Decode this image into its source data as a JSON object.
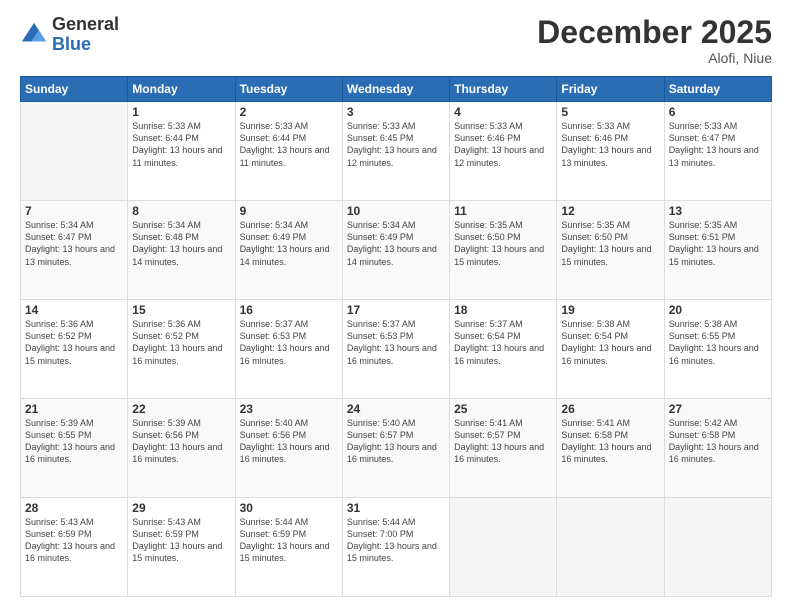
{
  "header": {
    "logo": {
      "general": "General",
      "blue": "Blue"
    },
    "title": "December 2025",
    "location": "Alofi, Niue"
  },
  "weekdays": [
    "Sunday",
    "Monday",
    "Tuesday",
    "Wednesday",
    "Thursday",
    "Friday",
    "Saturday"
  ],
  "weeks": [
    [
      {
        "day": "",
        "info": ""
      },
      {
        "day": "1",
        "info": "Sunrise: 5:33 AM\nSunset: 6:44 PM\nDaylight: 13 hours\nand 11 minutes."
      },
      {
        "day": "2",
        "info": "Sunrise: 5:33 AM\nSunset: 6:44 PM\nDaylight: 13 hours\nand 11 minutes."
      },
      {
        "day": "3",
        "info": "Sunrise: 5:33 AM\nSunset: 6:45 PM\nDaylight: 13 hours\nand 12 minutes."
      },
      {
        "day": "4",
        "info": "Sunrise: 5:33 AM\nSunset: 6:46 PM\nDaylight: 13 hours\nand 12 minutes."
      },
      {
        "day": "5",
        "info": "Sunrise: 5:33 AM\nSunset: 6:46 PM\nDaylight: 13 hours\nand 13 minutes."
      },
      {
        "day": "6",
        "info": "Sunrise: 5:33 AM\nSunset: 6:47 PM\nDaylight: 13 hours\nand 13 minutes."
      }
    ],
    [
      {
        "day": "7",
        "info": "Sunrise: 5:34 AM\nSunset: 6:47 PM\nDaylight: 13 hours\nand 13 minutes."
      },
      {
        "day": "8",
        "info": "Sunrise: 5:34 AM\nSunset: 6:48 PM\nDaylight: 13 hours\nand 14 minutes."
      },
      {
        "day": "9",
        "info": "Sunrise: 5:34 AM\nSunset: 6:49 PM\nDaylight: 13 hours\nand 14 minutes."
      },
      {
        "day": "10",
        "info": "Sunrise: 5:34 AM\nSunset: 6:49 PM\nDaylight: 13 hours\nand 14 minutes."
      },
      {
        "day": "11",
        "info": "Sunrise: 5:35 AM\nSunset: 6:50 PM\nDaylight: 13 hours\nand 15 minutes."
      },
      {
        "day": "12",
        "info": "Sunrise: 5:35 AM\nSunset: 6:50 PM\nDaylight: 13 hours\nand 15 minutes."
      },
      {
        "day": "13",
        "info": "Sunrise: 5:35 AM\nSunset: 6:51 PM\nDaylight: 13 hours\nand 15 minutes."
      }
    ],
    [
      {
        "day": "14",
        "info": "Sunrise: 5:36 AM\nSunset: 6:52 PM\nDaylight: 13 hours\nand 15 minutes."
      },
      {
        "day": "15",
        "info": "Sunrise: 5:36 AM\nSunset: 6:52 PM\nDaylight: 13 hours\nand 16 minutes."
      },
      {
        "day": "16",
        "info": "Sunrise: 5:37 AM\nSunset: 6:53 PM\nDaylight: 13 hours\nand 16 minutes."
      },
      {
        "day": "17",
        "info": "Sunrise: 5:37 AM\nSunset: 6:53 PM\nDaylight: 13 hours\nand 16 minutes."
      },
      {
        "day": "18",
        "info": "Sunrise: 5:37 AM\nSunset: 6:54 PM\nDaylight: 13 hours\nand 16 minutes."
      },
      {
        "day": "19",
        "info": "Sunrise: 5:38 AM\nSunset: 6:54 PM\nDaylight: 13 hours\nand 16 minutes."
      },
      {
        "day": "20",
        "info": "Sunrise: 5:38 AM\nSunset: 6:55 PM\nDaylight: 13 hours\nand 16 minutes."
      }
    ],
    [
      {
        "day": "21",
        "info": "Sunrise: 5:39 AM\nSunset: 6:55 PM\nDaylight: 13 hours\nand 16 minutes."
      },
      {
        "day": "22",
        "info": "Sunrise: 5:39 AM\nSunset: 6:56 PM\nDaylight: 13 hours\nand 16 minutes."
      },
      {
        "day": "23",
        "info": "Sunrise: 5:40 AM\nSunset: 6:56 PM\nDaylight: 13 hours\nand 16 minutes."
      },
      {
        "day": "24",
        "info": "Sunrise: 5:40 AM\nSunset: 6:57 PM\nDaylight: 13 hours\nand 16 minutes."
      },
      {
        "day": "25",
        "info": "Sunrise: 5:41 AM\nSunset: 6:57 PM\nDaylight: 13 hours\nand 16 minutes."
      },
      {
        "day": "26",
        "info": "Sunrise: 5:41 AM\nSunset: 6:58 PM\nDaylight: 13 hours\nand 16 minutes."
      },
      {
        "day": "27",
        "info": "Sunrise: 5:42 AM\nSunset: 6:58 PM\nDaylight: 13 hours\nand 16 minutes."
      }
    ],
    [
      {
        "day": "28",
        "info": "Sunrise: 5:43 AM\nSunset: 6:59 PM\nDaylight: 13 hours\nand 16 minutes."
      },
      {
        "day": "29",
        "info": "Sunrise: 5:43 AM\nSunset: 6:59 PM\nDaylight: 13 hours\nand 15 minutes."
      },
      {
        "day": "30",
        "info": "Sunrise: 5:44 AM\nSunset: 6:59 PM\nDaylight: 13 hours\nand 15 minutes."
      },
      {
        "day": "31",
        "info": "Sunrise: 5:44 AM\nSunset: 7:00 PM\nDaylight: 13 hours\nand 15 minutes."
      },
      {
        "day": "",
        "info": ""
      },
      {
        "day": "",
        "info": ""
      },
      {
        "day": "",
        "info": ""
      }
    ]
  ]
}
